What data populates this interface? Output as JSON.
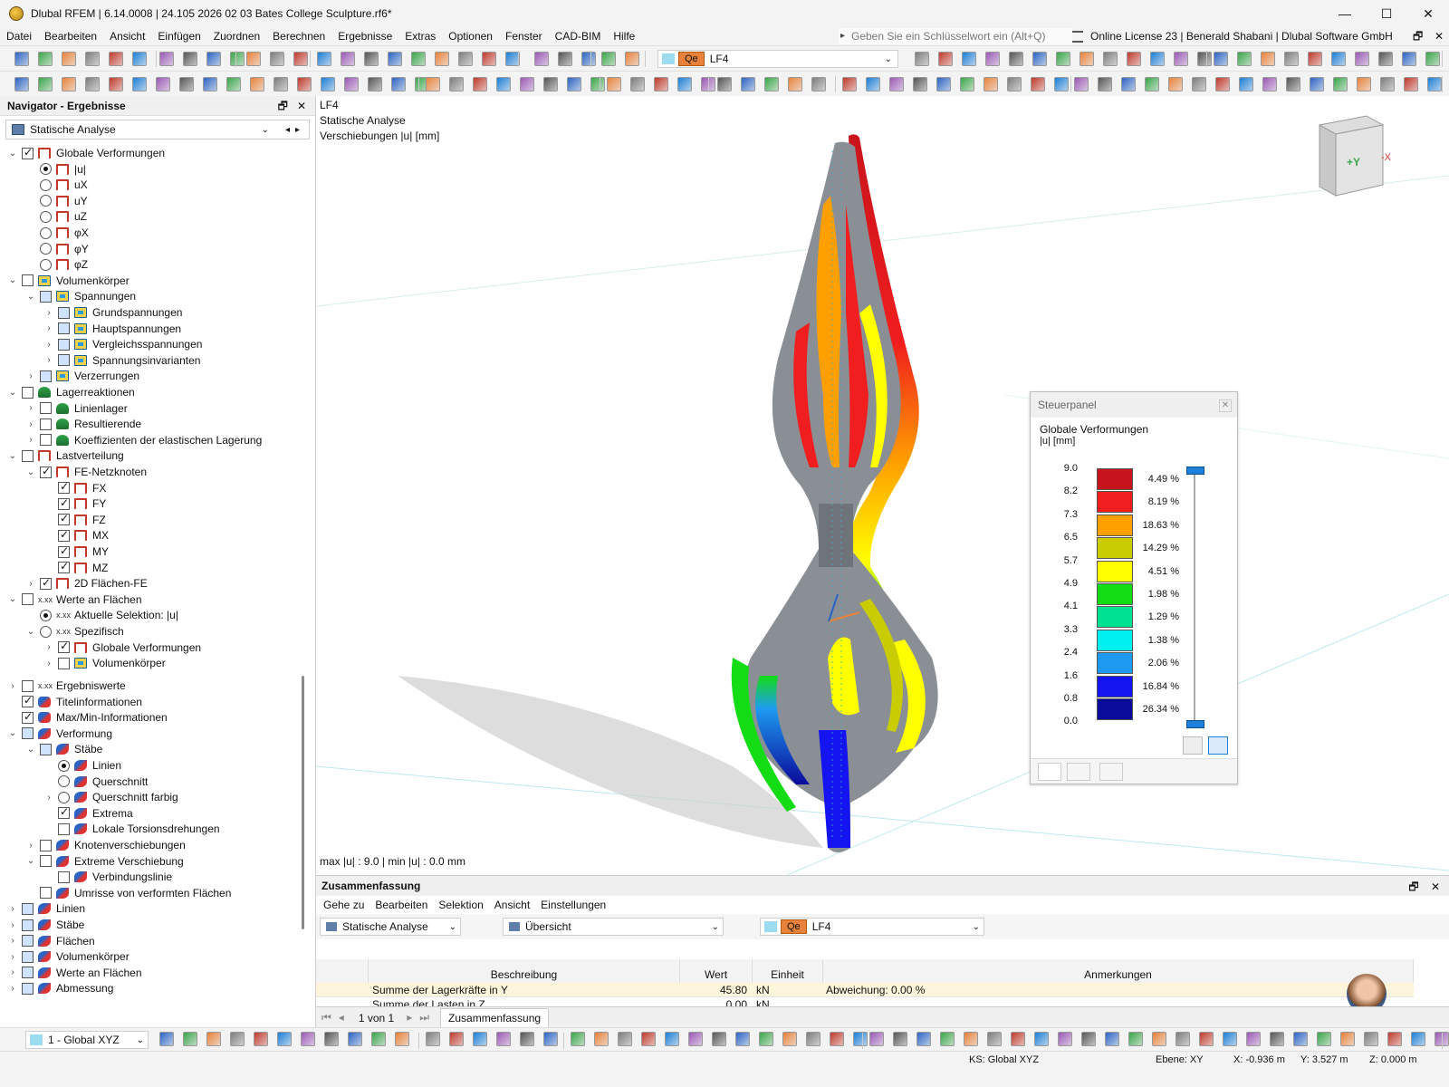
{
  "window": {
    "title": "Dlubal RFEM | 6.14.0008 | 24.105 2026 02 03 Bates College Sculpture.rf6*",
    "btn_min": "—",
    "btn_max": "☐",
    "btn_close": "✕"
  },
  "menu": {
    "items": [
      "Datei",
      "Bearbeiten",
      "Ansicht",
      "Einfügen",
      "Zuordnen",
      "Berechnen",
      "Ergebnisse",
      "Extras",
      "Optionen",
      "Fenster",
      "CAD-BIM",
      "Hilfe"
    ],
    "search_placeholder": "Geben Sie ein Schlüsselwort ein (Alt+Q)",
    "license": "Online License 23 | Benerald Shabani | Dlubal Software GmbH",
    "restore": "🗗",
    "close": "✕"
  },
  "toolbar": {
    "loadcase_badge": "Qe",
    "loadcase": "LF4"
  },
  "navigator": {
    "title": "Navigator - Ergebnisse",
    "pin": "🗗",
    "close": "✕",
    "analysis": "Statische Analyse",
    "items": [
      {
        "label": "Globale Verformungen",
        "level": 0,
        "exp": "v",
        "cb": "on",
        "icon": "def"
      },
      {
        "label": "|u|",
        "level": 1,
        "rb": "on",
        "icon": "def"
      },
      {
        "label": "uX",
        "level": 1,
        "rb": "off",
        "icon": "def"
      },
      {
        "label": "uY",
        "level": 1,
        "rb": "off",
        "icon": "def"
      },
      {
        "label": "uZ",
        "level": 1,
        "rb": "off",
        "icon": "def"
      },
      {
        "label": "φX",
        "level": 1,
        "rb": "off",
        "icon": "def"
      },
      {
        "label": "φY",
        "level": 1,
        "rb": "off",
        "icon": "def"
      },
      {
        "label": "φZ",
        "level": 1,
        "rb": "off",
        "icon": "def"
      },
      {
        "label": "Volumenkörper",
        "level": 0,
        "exp": "v",
        "cb": "off",
        "icon": "sol"
      },
      {
        "label": "Spannungen",
        "level": 1,
        "exp": "v",
        "cb": "part",
        "icon": "sol"
      },
      {
        "label": "Grundspannungen",
        "level": 2,
        "exp": ">",
        "cb": "part",
        "icon": "sol"
      },
      {
        "label": "Hauptspannungen",
        "level": 2,
        "exp": ">",
        "cb": "part",
        "icon": "sol"
      },
      {
        "label": "Vergleichsspannungen",
        "level": 2,
        "exp": ">",
        "cb": "part",
        "icon": "sol"
      },
      {
        "label": "Spannungsinvarianten",
        "level": 2,
        "exp": ">",
        "cb": "part",
        "icon": "sol"
      },
      {
        "label": "Verzerrungen",
        "level": 1,
        "exp": ">",
        "cb": "part",
        "icon": "sol"
      },
      {
        "label": "Lagerreaktionen",
        "level": 0,
        "exp": "v",
        "cb": "off",
        "icon": "sup"
      },
      {
        "label": "Linienlager",
        "level": 1,
        "exp": ">",
        "cb": "off",
        "icon": "sup"
      },
      {
        "label": "Resultierende",
        "level": 1,
        "exp": ">",
        "cb": "off",
        "icon": "sup"
      },
      {
        "label": "Koeffizienten der elastischen Lagerung",
        "level": 1,
        "exp": ">",
        "cb": "off",
        "icon": "sup"
      },
      {
        "label": "Lastverteilung",
        "level": 0,
        "exp": "v",
        "cb": "off",
        "icon": "def"
      },
      {
        "label": "FE-Netzknoten",
        "level": 1,
        "exp": "v",
        "cb": "on",
        "icon": "def"
      },
      {
        "label": "FX",
        "level": 2,
        "cb": "on",
        "icon": "def"
      },
      {
        "label": "FY",
        "level": 2,
        "cb": "on",
        "icon": "def"
      },
      {
        "label": "FZ",
        "level": 2,
        "cb": "on",
        "icon": "def"
      },
      {
        "label": "MX",
        "level": 2,
        "cb": "on",
        "icon": "def"
      },
      {
        "label": "MY",
        "level": 2,
        "cb": "on",
        "icon": "def"
      },
      {
        "label": "MZ",
        "level": 2,
        "cb": "on",
        "icon": "def"
      },
      {
        "label": "2D Flächen-FE",
        "level": 1,
        "exp": ">",
        "cb": "on",
        "icon": "def"
      },
      {
        "label": "Werte an Flächen",
        "level": 0,
        "exp": "v",
        "cb": "off",
        "icon": "val"
      },
      {
        "label": "Aktuelle Selektion: |u|",
        "level": 1,
        "rb": "on",
        "icon": "val"
      },
      {
        "label": "Spezifisch",
        "level": 1,
        "exp": "v",
        "rb": "off",
        "icon": "val"
      },
      {
        "label": "Globale Verformungen",
        "level": 2,
        "exp": ">",
        "cb": "on",
        "icon": "def"
      },
      {
        "label": "Volumenkörper",
        "level": 2,
        "exp": ">",
        "cb": "off",
        "icon": "sol"
      }
    ],
    "items2": [
      {
        "label": "Ergebniswerte",
        "level": 0,
        "exp": ">",
        "cb": "off",
        "icon": "val"
      },
      {
        "label": "Titelinformationen",
        "level": 0,
        "cb": "on",
        "icon": "ttl"
      },
      {
        "label": "Max/Min-Informationen",
        "level": 0,
        "cb": "on",
        "icon": "ttl"
      },
      {
        "label": "Verformung",
        "level": 0,
        "exp": "v",
        "cb": "part",
        "icon": "defm"
      },
      {
        "label": "Stäbe",
        "level": 1,
        "exp": "v",
        "cb": "part",
        "icon": "defm"
      },
      {
        "label": "Linien",
        "level": 2,
        "rb": "on",
        "icon": "defm"
      },
      {
        "label": "Querschnitt",
        "level": 2,
        "rb": "off",
        "icon": "defm"
      },
      {
        "label": "Querschnitt farbig",
        "level": 2,
        "exp": ">",
        "rb": "off",
        "icon": "defm"
      },
      {
        "label": "Extrema",
        "level": 2,
        "cb": "on",
        "icon": "defm"
      },
      {
        "label": "Lokale Torsionsdrehungen",
        "level": 2,
        "cb": "off",
        "icon": "defm"
      },
      {
        "label": "Knotenverschiebungen",
        "level": 1,
        "exp": ">",
        "cb": "off",
        "icon": "defm"
      },
      {
        "label": "Extreme Verschiebung",
        "level": 1,
        "exp": "v",
        "cb": "off",
        "icon": "defm"
      },
      {
        "label": "Verbindungslinie",
        "level": 2,
        "cb": "off",
        "icon": "defm"
      },
      {
        "label": "Umrisse von verformten Flächen",
        "level": 1,
        "cb": "off",
        "icon": "defm"
      },
      {
        "label": "Linien",
        "level": 0,
        "exp": ">",
        "cb": "part",
        "icon": "defm"
      },
      {
        "label": "Stäbe",
        "level": 0,
        "exp": ">",
        "cb": "part",
        "icon": "defm"
      },
      {
        "label": "Flächen",
        "level": 0,
        "exp": ">",
        "cb": "part",
        "icon": "defm"
      },
      {
        "label": "Volumenkörper",
        "level": 0,
        "exp": ">",
        "cb": "part",
        "icon": "defm"
      },
      {
        "label": "Werte an Flächen",
        "level": 0,
        "exp": ">",
        "cb": "part",
        "icon": "defm"
      },
      {
        "label": "Abmessung",
        "level": 0,
        "exp": ">",
        "cb": "part",
        "icon": "defm"
      }
    ]
  },
  "viewport": {
    "line1": "LF4",
    "line2": "Statische Analyse",
    "line3": "Verschiebungen |u| [mm]",
    "maxmin": "max |u| : 9.0 | min |u| : 0.0 mm",
    "cube_y": "+Y",
    "cube_x": "-X"
  },
  "panel": {
    "title": "Steuerpanel",
    "close": "✕",
    "heading": "Globale Verformungen",
    "unit": "|u| [mm]",
    "values": [
      "9.0",
      "8.2",
      "7.3",
      "6.5",
      "5.7",
      "4.9",
      "4.1",
      "3.3",
      "2.4",
      "1.6",
      "0.8",
      "0.0"
    ],
    "bands": [
      {
        "color": "#c8141c",
        "pct": "4.49 %"
      },
      {
        "color": "#f01e1e",
        "pct": "8.19 %"
      },
      {
        "color": "#ff9f00",
        "pct": "18.63 %"
      },
      {
        "color": "#c9cc00",
        "pct": "14.29 %"
      },
      {
        "color": "#ffff00",
        "pct": "4.51 %"
      },
      {
        "color": "#14dc14",
        "pct": "1.98 %"
      },
      {
        "color": "#00e191",
        "pct": "1.29 %"
      },
      {
        "color": "#00f0f0",
        "pct": "1.38 %"
      },
      {
        "color": "#1e9bf0",
        "pct": "2.06 %"
      },
      {
        "color": "#1414f0",
        "pct": "16.84 %"
      },
      {
        "color": "#0a0a9b",
        "pct": "26.34 %"
      }
    ]
  },
  "summary": {
    "title": "Zusammenfassung",
    "pin": "🗗",
    "close": "✕",
    "menu": [
      "Gehe zu",
      "Bearbeiten",
      "Selektion",
      "Ansicht",
      "Einstellungen"
    ],
    "analysis": "Statische Analyse",
    "view": "Übersicht",
    "lc_badge": "Qe",
    "lc": "LF4",
    "columns": [
      "Beschreibung",
      "Wert",
      "Einheit",
      "Anmerkungen"
    ],
    "rows": [
      {
        "desc": "Summe der Lagerkräfte in Y",
        "val": "45.80",
        "unit": "kN",
        "note": "Abweichung: 0.00 %"
      },
      {
        "desc": "Summe der Lasten in Z",
        "val": "0.00",
        "unit": "kN",
        "note": ""
      }
    ],
    "pager": "1 von 1",
    "tab": "Zusammenfassung"
  },
  "bottom": {
    "coord_system": "1 - Global XYZ"
  },
  "status": {
    "ks": "KS: Global XYZ",
    "ebene": "Ebene: XY",
    "x": "X: -0.936 m",
    "y": "Y: 3.527 m",
    "z": "Z: 0.000 m"
  }
}
